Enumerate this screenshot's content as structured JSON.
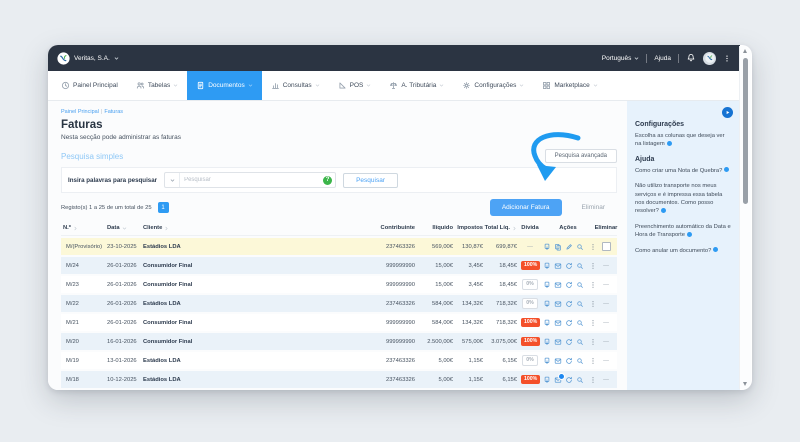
{
  "topbar": {
    "company": "Veritas, S.A.",
    "language": "Português",
    "help": "Ajuda"
  },
  "nav": {
    "items": [
      {
        "label": "Painel Principal",
        "icon": "dashboard-icon",
        "caret": false,
        "active": false
      },
      {
        "label": "Tabelas",
        "icon": "users-icon",
        "caret": true,
        "active": false
      },
      {
        "label": "Documentos",
        "icon": "document-icon",
        "caret": true,
        "active": true
      },
      {
        "label": "Consultas",
        "icon": "chart-icon",
        "caret": true,
        "active": false
      },
      {
        "label": "POS",
        "icon": "pos-icon",
        "caret": true,
        "active": false
      },
      {
        "label": "A. Tributária",
        "icon": "tax-icon",
        "caret": true,
        "active": false
      },
      {
        "label": "Configurações",
        "icon": "gear-icon",
        "caret": true,
        "active": false
      },
      {
        "label": "Marketplace",
        "icon": "grid-icon",
        "caret": true,
        "active": false
      }
    ]
  },
  "breadcrumb": {
    "home": "Painel Principal",
    "separator": "|",
    "current": "Faturas"
  },
  "page": {
    "title": "Faturas",
    "subtitle": "Nesta secção pode administrar as faturas"
  },
  "search": {
    "section": "Pesquisa simples",
    "advanced": "Pesquisa avançada",
    "label": "Insira palavras para pesquisar",
    "placeholder": "Pesquisar",
    "help_glyph": "?",
    "button": "Pesquisar"
  },
  "records": {
    "text": "Registo(s) 1 a 25 de um total de 25",
    "page": "1"
  },
  "actions": {
    "add": "Adicionar Fatura",
    "remove": "Eliminar"
  },
  "table": {
    "headers": [
      {
        "label": "N.º",
        "sort": "right"
      },
      {
        "label": "Data",
        "sort": "down"
      },
      {
        "label": "Cliente",
        "sort": "right"
      },
      {
        "label": "Contribuinte",
        "sort": null
      },
      {
        "label": "Ilíquido",
        "sort": null
      },
      {
        "label": "Impostos",
        "sort": null
      },
      {
        "label": "Total Líq.",
        "sort": "right"
      },
      {
        "label": "Dívida",
        "sort": null
      },
      {
        "label": "Ações",
        "sort": null
      },
      {
        "label": "Eliminar",
        "sort": null
      }
    ],
    "rows": [
      {
        "number": "M/(Provisório)",
        "date": "23-10-2025",
        "client": "Estádios LDA",
        "vat": "237463326",
        "net": "569,00€",
        "taxes": "130,87€",
        "total": "699,87€",
        "debt": "—",
        "debt_style": "none",
        "actions": [
          "pdf-icon",
          "copy-icon",
          "edit-icon",
          "magnifier-icon",
          "more-icon"
        ],
        "badge_on": null,
        "remove": "checkbox",
        "highlight": "yellow"
      },
      {
        "number": "M/24",
        "date": "26-01-2026",
        "client": "Consumidor Final",
        "vat": "999999990",
        "net": "15,00€",
        "taxes": "3,45€",
        "total": "18,45€",
        "debt": "100%",
        "debt_style": "filled",
        "actions": [
          "pdf-icon",
          "envelope-icon",
          "refresh-icon",
          "magnifier-icon",
          "more-icon"
        ],
        "badge_on": null,
        "remove": "—",
        "highlight": "blue"
      },
      {
        "number": "M/23",
        "date": "26-01-2026",
        "client": "Consumidor Final",
        "vat": "999999990",
        "net": "15,00€",
        "taxes": "3,45€",
        "total": "18,45€",
        "debt": "0%",
        "debt_style": "outline",
        "actions": [
          "pdf-icon",
          "envelope-icon",
          "refresh-icon",
          "magnifier-icon",
          "more-icon"
        ],
        "badge_on": null,
        "remove": "—",
        "highlight": "white"
      },
      {
        "number": "M/22",
        "date": "26-01-2026",
        "client": "Estádios LDA",
        "vat": "237463326",
        "net": "584,00€",
        "taxes": "134,32€",
        "total": "718,32€",
        "debt": "0%",
        "debt_style": "outline",
        "actions": [
          "pdf-icon",
          "envelope-icon",
          "refresh-icon",
          "magnifier-icon",
          "more-icon"
        ],
        "badge_on": null,
        "remove": "—",
        "highlight": "blue"
      },
      {
        "number": "M/21",
        "date": "26-01-2026",
        "client": "Consumidor Final",
        "vat": "999999990",
        "net": "584,00€",
        "taxes": "134,32€",
        "total": "718,32€",
        "debt": "100%",
        "debt_style": "filled",
        "actions": [
          "pdf-icon",
          "envelope-icon",
          "refresh-icon",
          "magnifier-icon",
          "more-icon"
        ],
        "badge_on": null,
        "remove": "—",
        "highlight": "white"
      },
      {
        "number": "M/20",
        "date": "16-01-2026",
        "client": "Consumidor Final",
        "vat": "999999990",
        "net": "2.500,00€",
        "taxes": "575,00€",
        "total": "3.075,00€",
        "debt": "100%",
        "debt_style": "filled",
        "actions": [
          "pdf-icon",
          "envelope-icon",
          "refresh-icon",
          "magnifier-icon",
          "more-icon"
        ],
        "badge_on": null,
        "remove": "—",
        "highlight": "blue"
      },
      {
        "number": "M/19",
        "date": "13-01-2026",
        "client": "Estádios LDA",
        "vat": "237463326",
        "net": "5,00€",
        "taxes": "1,15€",
        "total": "6,15€",
        "debt": "0%",
        "debt_style": "outline",
        "actions": [
          "pdf-icon",
          "envelope-icon",
          "refresh-icon",
          "magnifier-icon",
          "more-icon"
        ],
        "badge_on": null,
        "remove": "—",
        "highlight": "white"
      },
      {
        "number": "M/18",
        "date": "10-12-2025",
        "client": "Estádios LDA",
        "vat": "237463326",
        "net": "5,00€",
        "taxes": "1,15€",
        "total": "6,15€",
        "debt": "100%",
        "debt_style": "filled",
        "actions": [
          "pdf-icon",
          "envelope-icon",
          "refresh-icon",
          "magnifier-icon",
          "more-icon"
        ],
        "badge_on": "envelope-icon",
        "remove": "—",
        "highlight": "blue"
      }
    ]
  },
  "sidebar": {
    "settings_title": "Configurações",
    "settings_links": [
      "Escolha as colunas que deseja ver na listagem"
    ],
    "help_title": "Ajuda",
    "help_links": [
      "Como criar uma Nota de Quebra?",
      "Não utilizo transporte nos meus serviços e é impressa essa tabela nos documentos. Como posso resolver?",
      "Preenchimento automático da Data e Hora de Transporte",
      "Como anular um documento?"
    ]
  },
  "colors": {
    "accent": "#2e9bf3",
    "accent_button": "#4da3f5",
    "danger": "#f4502a",
    "topbar_bg": "#2b3442",
    "sidebar_bg": "#e7f2fc",
    "row_highlight_yellow": "#fcf8d8",
    "row_highlight_blue": "#eaf2f9",
    "help_green": "#3cb54a"
  }
}
